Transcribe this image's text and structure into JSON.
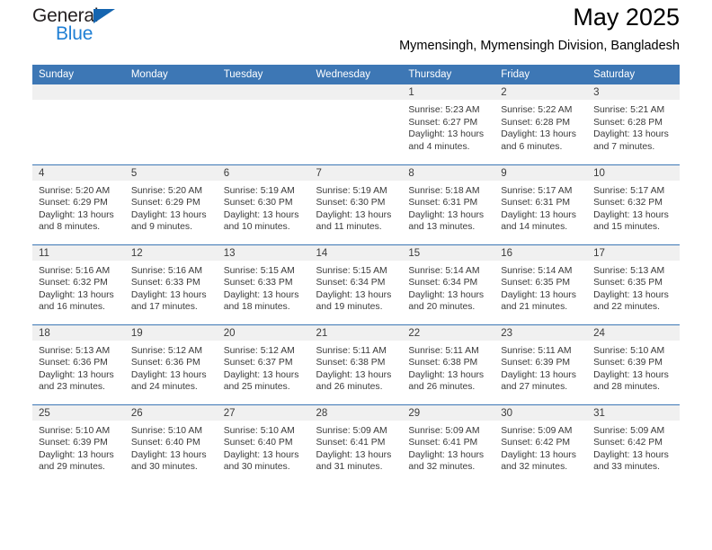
{
  "brand": {
    "name_top": "General",
    "name_bottom": "Blue",
    "accent_color": "#1f7fd4",
    "triangle_color": "#1565b0"
  },
  "header": {
    "title": "May 2025",
    "subtitle": "Mymensingh, Mymensingh Division, Bangladesh",
    "header_bg": "#3d77b5",
    "daynum_bg": "#f0f0f0"
  },
  "weekdays": [
    "Sunday",
    "Monday",
    "Tuesday",
    "Wednesday",
    "Thursday",
    "Friday",
    "Saturday"
  ],
  "labels": {
    "sunrise": "Sunrise:",
    "sunset": "Sunset:",
    "daylight": "Daylight:"
  },
  "weeks": [
    [
      {
        "day": "",
        "empty": true
      },
      {
        "day": "",
        "empty": true
      },
      {
        "day": "",
        "empty": true
      },
      {
        "day": "",
        "empty": true
      },
      {
        "day": "1",
        "sunrise": "Sunrise: 5:23 AM",
        "sunset": "Sunset: 6:27 PM",
        "daylight": "Daylight: 13 hours and 4 minutes."
      },
      {
        "day": "2",
        "sunrise": "Sunrise: 5:22 AM",
        "sunset": "Sunset: 6:28 PM",
        "daylight": "Daylight: 13 hours and 6 minutes."
      },
      {
        "day": "3",
        "sunrise": "Sunrise: 5:21 AM",
        "sunset": "Sunset: 6:28 PM",
        "daylight": "Daylight: 13 hours and 7 minutes."
      }
    ],
    [
      {
        "day": "4",
        "sunrise": "Sunrise: 5:20 AM",
        "sunset": "Sunset: 6:29 PM",
        "daylight": "Daylight: 13 hours and 8 minutes."
      },
      {
        "day": "5",
        "sunrise": "Sunrise: 5:20 AM",
        "sunset": "Sunset: 6:29 PM",
        "daylight": "Daylight: 13 hours and 9 minutes."
      },
      {
        "day": "6",
        "sunrise": "Sunrise: 5:19 AM",
        "sunset": "Sunset: 6:30 PM",
        "daylight": "Daylight: 13 hours and 10 minutes."
      },
      {
        "day": "7",
        "sunrise": "Sunrise: 5:19 AM",
        "sunset": "Sunset: 6:30 PM",
        "daylight": "Daylight: 13 hours and 11 minutes."
      },
      {
        "day": "8",
        "sunrise": "Sunrise: 5:18 AM",
        "sunset": "Sunset: 6:31 PM",
        "daylight": "Daylight: 13 hours and 13 minutes."
      },
      {
        "day": "9",
        "sunrise": "Sunrise: 5:17 AM",
        "sunset": "Sunset: 6:31 PM",
        "daylight": "Daylight: 13 hours and 14 minutes."
      },
      {
        "day": "10",
        "sunrise": "Sunrise: 5:17 AM",
        "sunset": "Sunset: 6:32 PM",
        "daylight": "Daylight: 13 hours and 15 minutes."
      }
    ],
    [
      {
        "day": "11",
        "sunrise": "Sunrise: 5:16 AM",
        "sunset": "Sunset: 6:32 PM",
        "daylight": "Daylight: 13 hours and 16 minutes."
      },
      {
        "day": "12",
        "sunrise": "Sunrise: 5:16 AM",
        "sunset": "Sunset: 6:33 PM",
        "daylight": "Daylight: 13 hours and 17 minutes."
      },
      {
        "day": "13",
        "sunrise": "Sunrise: 5:15 AM",
        "sunset": "Sunset: 6:33 PM",
        "daylight": "Daylight: 13 hours and 18 minutes."
      },
      {
        "day": "14",
        "sunrise": "Sunrise: 5:15 AM",
        "sunset": "Sunset: 6:34 PM",
        "daylight": "Daylight: 13 hours and 19 minutes."
      },
      {
        "day": "15",
        "sunrise": "Sunrise: 5:14 AM",
        "sunset": "Sunset: 6:34 PM",
        "daylight": "Daylight: 13 hours and 20 minutes."
      },
      {
        "day": "16",
        "sunrise": "Sunrise: 5:14 AM",
        "sunset": "Sunset: 6:35 PM",
        "daylight": "Daylight: 13 hours and 21 minutes."
      },
      {
        "day": "17",
        "sunrise": "Sunrise: 5:13 AM",
        "sunset": "Sunset: 6:35 PM",
        "daylight": "Daylight: 13 hours and 22 minutes."
      }
    ],
    [
      {
        "day": "18",
        "sunrise": "Sunrise: 5:13 AM",
        "sunset": "Sunset: 6:36 PM",
        "daylight": "Daylight: 13 hours and 23 minutes."
      },
      {
        "day": "19",
        "sunrise": "Sunrise: 5:12 AM",
        "sunset": "Sunset: 6:36 PM",
        "daylight": "Daylight: 13 hours and 24 minutes."
      },
      {
        "day": "20",
        "sunrise": "Sunrise: 5:12 AM",
        "sunset": "Sunset: 6:37 PM",
        "daylight": "Daylight: 13 hours and 25 minutes."
      },
      {
        "day": "21",
        "sunrise": "Sunrise: 5:11 AM",
        "sunset": "Sunset: 6:38 PM",
        "daylight": "Daylight: 13 hours and 26 minutes."
      },
      {
        "day": "22",
        "sunrise": "Sunrise: 5:11 AM",
        "sunset": "Sunset: 6:38 PM",
        "daylight": "Daylight: 13 hours and 26 minutes."
      },
      {
        "day": "23",
        "sunrise": "Sunrise: 5:11 AM",
        "sunset": "Sunset: 6:39 PM",
        "daylight": "Daylight: 13 hours and 27 minutes."
      },
      {
        "day": "24",
        "sunrise": "Sunrise: 5:10 AM",
        "sunset": "Sunset: 6:39 PM",
        "daylight": "Daylight: 13 hours and 28 minutes."
      }
    ],
    [
      {
        "day": "25",
        "sunrise": "Sunrise: 5:10 AM",
        "sunset": "Sunset: 6:39 PM",
        "daylight": "Daylight: 13 hours and 29 minutes."
      },
      {
        "day": "26",
        "sunrise": "Sunrise: 5:10 AM",
        "sunset": "Sunset: 6:40 PM",
        "daylight": "Daylight: 13 hours and 30 minutes."
      },
      {
        "day": "27",
        "sunrise": "Sunrise: 5:10 AM",
        "sunset": "Sunset: 6:40 PM",
        "daylight": "Daylight: 13 hours and 30 minutes."
      },
      {
        "day": "28",
        "sunrise": "Sunrise: 5:09 AM",
        "sunset": "Sunset: 6:41 PM",
        "daylight": "Daylight: 13 hours and 31 minutes."
      },
      {
        "day": "29",
        "sunrise": "Sunrise: 5:09 AM",
        "sunset": "Sunset: 6:41 PM",
        "daylight": "Daylight: 13 hours and 32 minutes."
      },
      {
        "day": "30",
        "sunrise": "Sunrise: 5:09 AM",
        "sunset": "Sunset: 6:42 PM",
        "daylight": "Daylight: 13 hours and 32 minutes."
      },
      {
        "day": "31",
        "sunrise": "Sunrise: 5:09 AM",
        "sunset": "Sunset: 6:42 PM",
        "daylight": "Daylight: 13 hours and 33 minutes."
      }
    ]
  ]
}
